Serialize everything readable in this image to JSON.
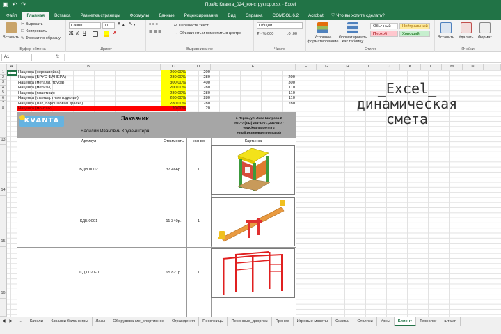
{
  "window": {
    "title": "Прайс Кванта_024_конструктор.xlsx  -  Excel"
  },
  "ribbon_tabs": [
    "Файл",
    "Главная",
    "Вставка",
    "Разметка страницы",
    "Формулы",
    "Данные",
    "Рецензирование",
    "Вид",
    "Справка",
    "COMSOL 6.2",
    "Acrobat"
  ],
  "tell_me": "Что вы хотите сделать?",
  "ribbon": {
    "paste": "Вставить",
    "cut": "Вырезать",
    "copy": "Копировать",
    "format_painter": "Формат по образцу",
    "clipboard_label": "Буфер обмена",
    "font_name": "Calibri",
    "font_size": "11",
    "font_label": "Шрифт",
    "wrap_text": "Перенести текст",
    "merge_center": "Объединить и поместить в центре",
    "alignment_label": "Выравнивание",
    "number_format": "Общий",
    "number_label": "Число",
    "conditional_formatting": "Условное форматирование",
    "format_as_table": "Форматировать как таблицу",
    "style_normal": "Обычный",
    "style_neutral": "Нейтральный",
    "style_bad": "Плохой",
    "style_good": "Хороший",
    "styles_label": "Стили",
    "insert": "Вставить",
    "delete": "Удалить",
    "format": "Формат",
    "cells_label": "Ячейки"
  },
  "name_box": "A1",
  "fx": "fx",
  "columns": [
    "A",
    "B",
    "C",
    "D",
    "E",
    "F",
    "G",
    "H",
    "I",
    "J",
    "K",
    "L",
    "M",
    "N",
    "O"
  ],
  "rows": [
    {
      "num": "1",
      "label": "Наценка (нержавейка)",
      "pct": "200,00%",
      "d": "200",
      "e": ""
    },
    {
      "num": "2",
      "label": "Наценка (БРУС ФАНЕРА)",
      "pct": "280,00%",
      "d": "280",
      "e": "200"
    },
    {
      "num": "3",
      "label": "Наценка (металл, труба)",
      "pct": "300,00%",
      "d": "400",
      "e": "300"
    },
    {
      "num": "4",
      "label": "Наценка (метизы)",
      "pct": "200,00%",
      "d": "280",
      "e": "110"
    },
    {
      "num": "5",
      "label": "Наценка (пластики)",
      "pct": "280,00%",
      "d": "280",
      "e": "110"
    },
    {
      "num": "6",
      "label": "Наценка (стандартные изделия)",
      "pct": "280,00%",
      "d": "280",
      "e": "110"
    },
    {
      "num": "7",
      "label": "Наценка (Лак, порошковая краска)",
      "pct": "280,00%",
      "d": "280",
      "e": "280"
    },
    {
      "num": "8",
      "label": "Наценка (монтаж)",
      "pct": "20,00%",
      "d": "20",
      "e": ""
    }
  ],
  "header_block": {
    "logo": "KVANTA",
    "customer_title": "Заказчик",
    "customer_name": "Василий Иванович Крузенштерн",
    "address": "г. Пермь, ул. Льва Шатрова 2",
    "phone": "тел.+7 (342) 234-53-77, 234-54-77",
    "site": "www.kvanta-perm.ru",
    "email": "e-mail:резиновая-плитка.рф"
  },
  "table_headers": {
    "article": "Артикул",
    "cost": "Стоимость",
    "qty": "кол-во",
    "picture": "Картинка"
  },
  "items": [
    {
      "row": "14",
      "article": "БДИ.0002",
      "cost": "37 466р.",
      "qty": "1"
    },
    {
      "row": "15",
      "article": "КДБ.0001",
      "cost": "11 340р.",
      "qty": "1"
    },
    {
      "row": "16",
      "article": "ОСД.0021-01",
      "cost": "65 821р.",
      "qty": "1"
    }
  ],
  "overlay": {
    "line1": "_Excel_",
    "line2": "динамическая",
    "line3": "смета"
  },
  "sheet_tabs": [
    "...",
    "Качели",
    "Качалки-балансиры",
    "Лазы",
    "Оборудование_спортивное",
    "Ограждения",
    "Песочницы",
    "Песочные_дворики",
    "Прочее",
    "Игровые макеты",
    "Скамьи",
    "Столики",
    "Урны",
    "Клиент",
    "Технолог",
    "штамп"
  ],
  "active_sheet": "Клиент",
  "colors": {
    "excel_green": "#217346",
    "highlight_yellow": "#ffff00",
    "highlight_red": "#ff0000",
    "header_gray": "#a6a6a6"
  }
}
